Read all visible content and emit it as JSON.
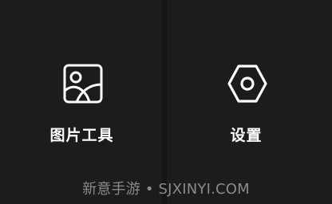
{
  "tiles": [
    {
      "label": "图片工具",
      "icon": "image-icon"
    },
    {
      "label": "设置",
      "icon": "settings-nut-icon"
    }
  ],
  "watermark": "新意手游 • SJXINYI.COM",
  "colors": {
    "background": "#141414",
    "tile": "#1c1c1c",
    "foreground": "#ffffff",
    "watermark": "#8a8a8a"
  }
}
